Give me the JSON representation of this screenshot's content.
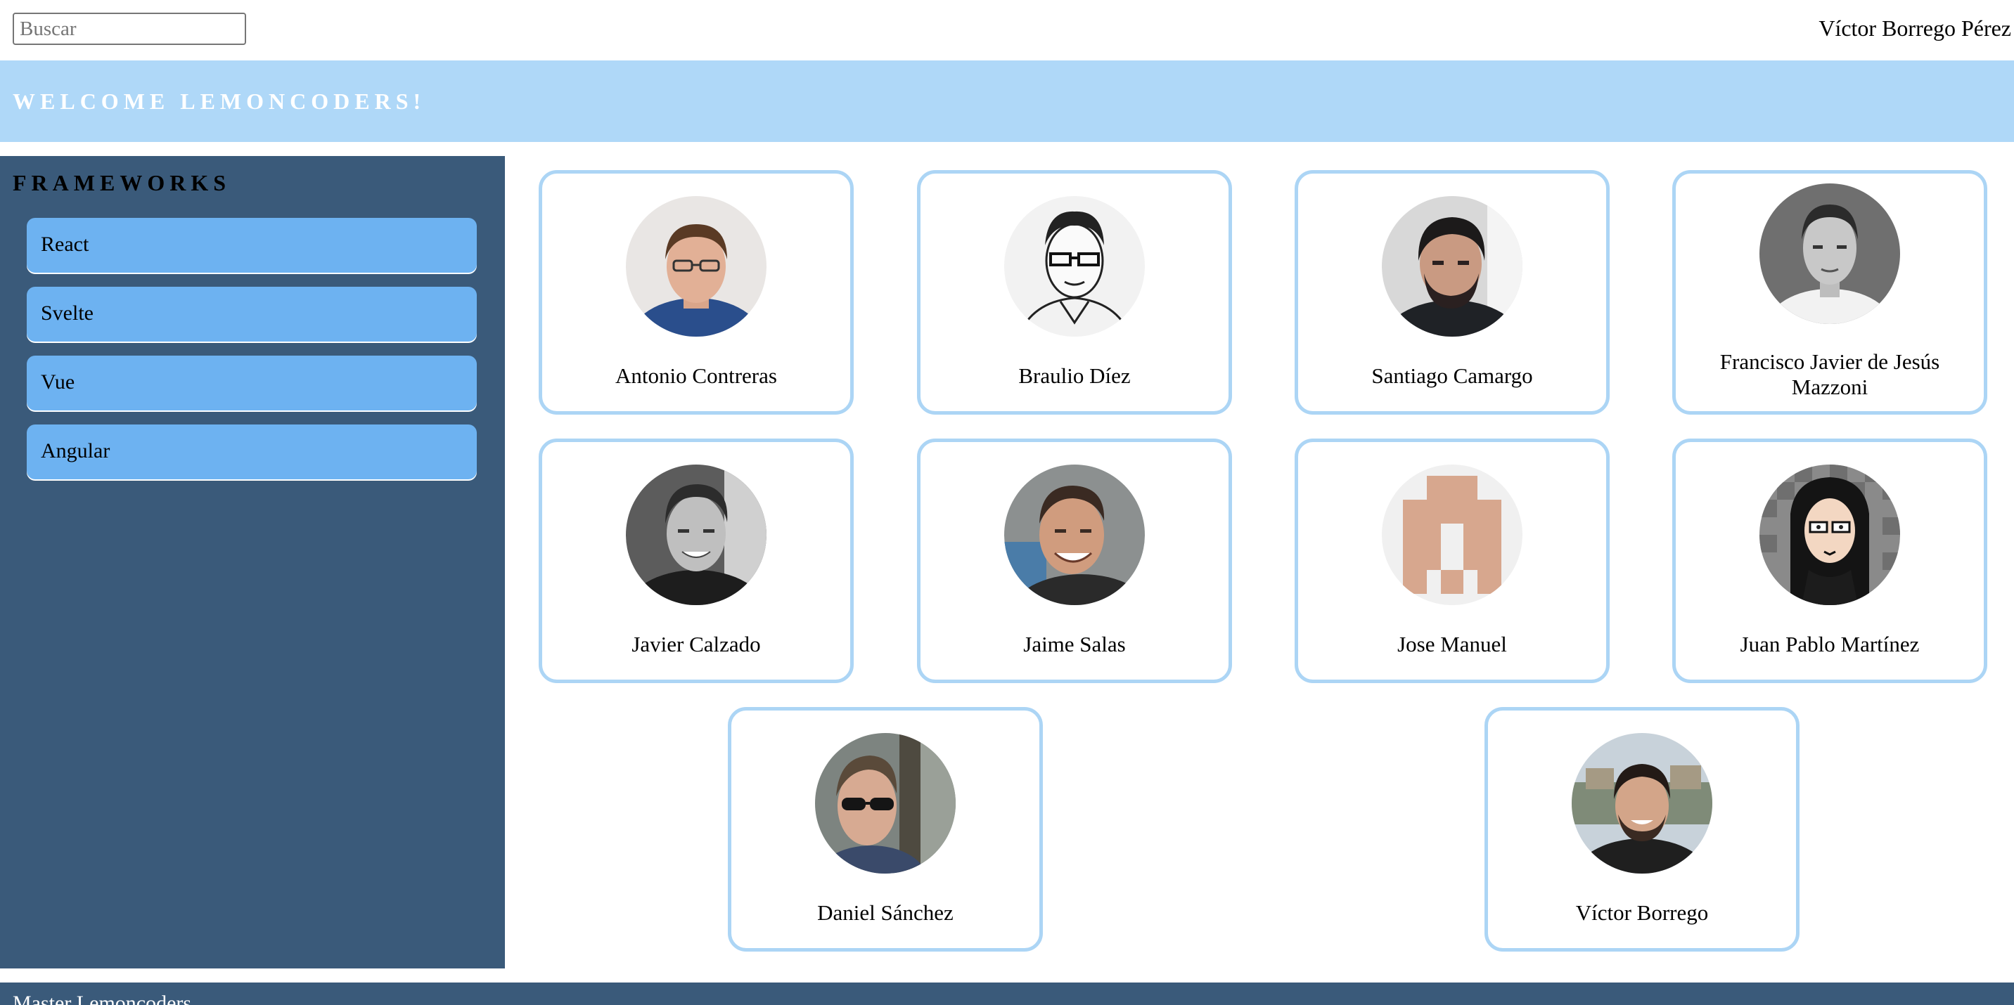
{
  "header": {
    "search_placeholder": "Buscar",
    "search_value": "",
    "user_name": "Víctor Borrego Pérez"
  },
  "banner": {
    "title": "WELCOME LEMONCODERS!"
  },
  "sidebar": {
    "title": "FRAMEWORKS",
    "items": [
      {
        "label": "React"
      },
      {
        "label": "Svelte"
      },
      {
        "label": "Vue"
      },
      {
        "label": "Angular"
      }
    ]
  },
  "members": [
    {
      "name": "Antonio Contreras",
      "avatar": "photo"
    },
    {
      "name": "Braulio Díez",
      "avatar": "sketch"
    },
    {
      "name": "Santiago Camargo",
      "avatar": "photo"
    },
    {
      "name": "Francisco Javier de Jesús Mazzoni",
      "avatar": "photo-grayscale"
    },
    {
      "name": "Javier Calzado",
      "avatar": "photo-grayscale"
    },
    {
      "name": "Jaime Salas",
      "avatar": "photo"
    },
    {
      "name": "Jose Manuel",
      "avatar": "identicon"
    },
    {
      "name": "Juan Pablo Martínez",
      "avatar": "cartoon"
    },
    {
      "name": "Daniel Sánchez",
      "avatar": "photo"
    },
    {
      "name": "Víctor Borrego",
      "avatar": "photo"
    }
  ],
  "footer": {
    "text": "Master Lemoncoders"
  },
  "colors": {
    "banner_bg": "#afd8f8",
    "sidebar_bg": "#3a5a7a",
    "sidebar_item_bg": "#6db2f1",
    "card_border": "#acd5f5",
    "footer_bg": "#3a5a7a"
  }
}
